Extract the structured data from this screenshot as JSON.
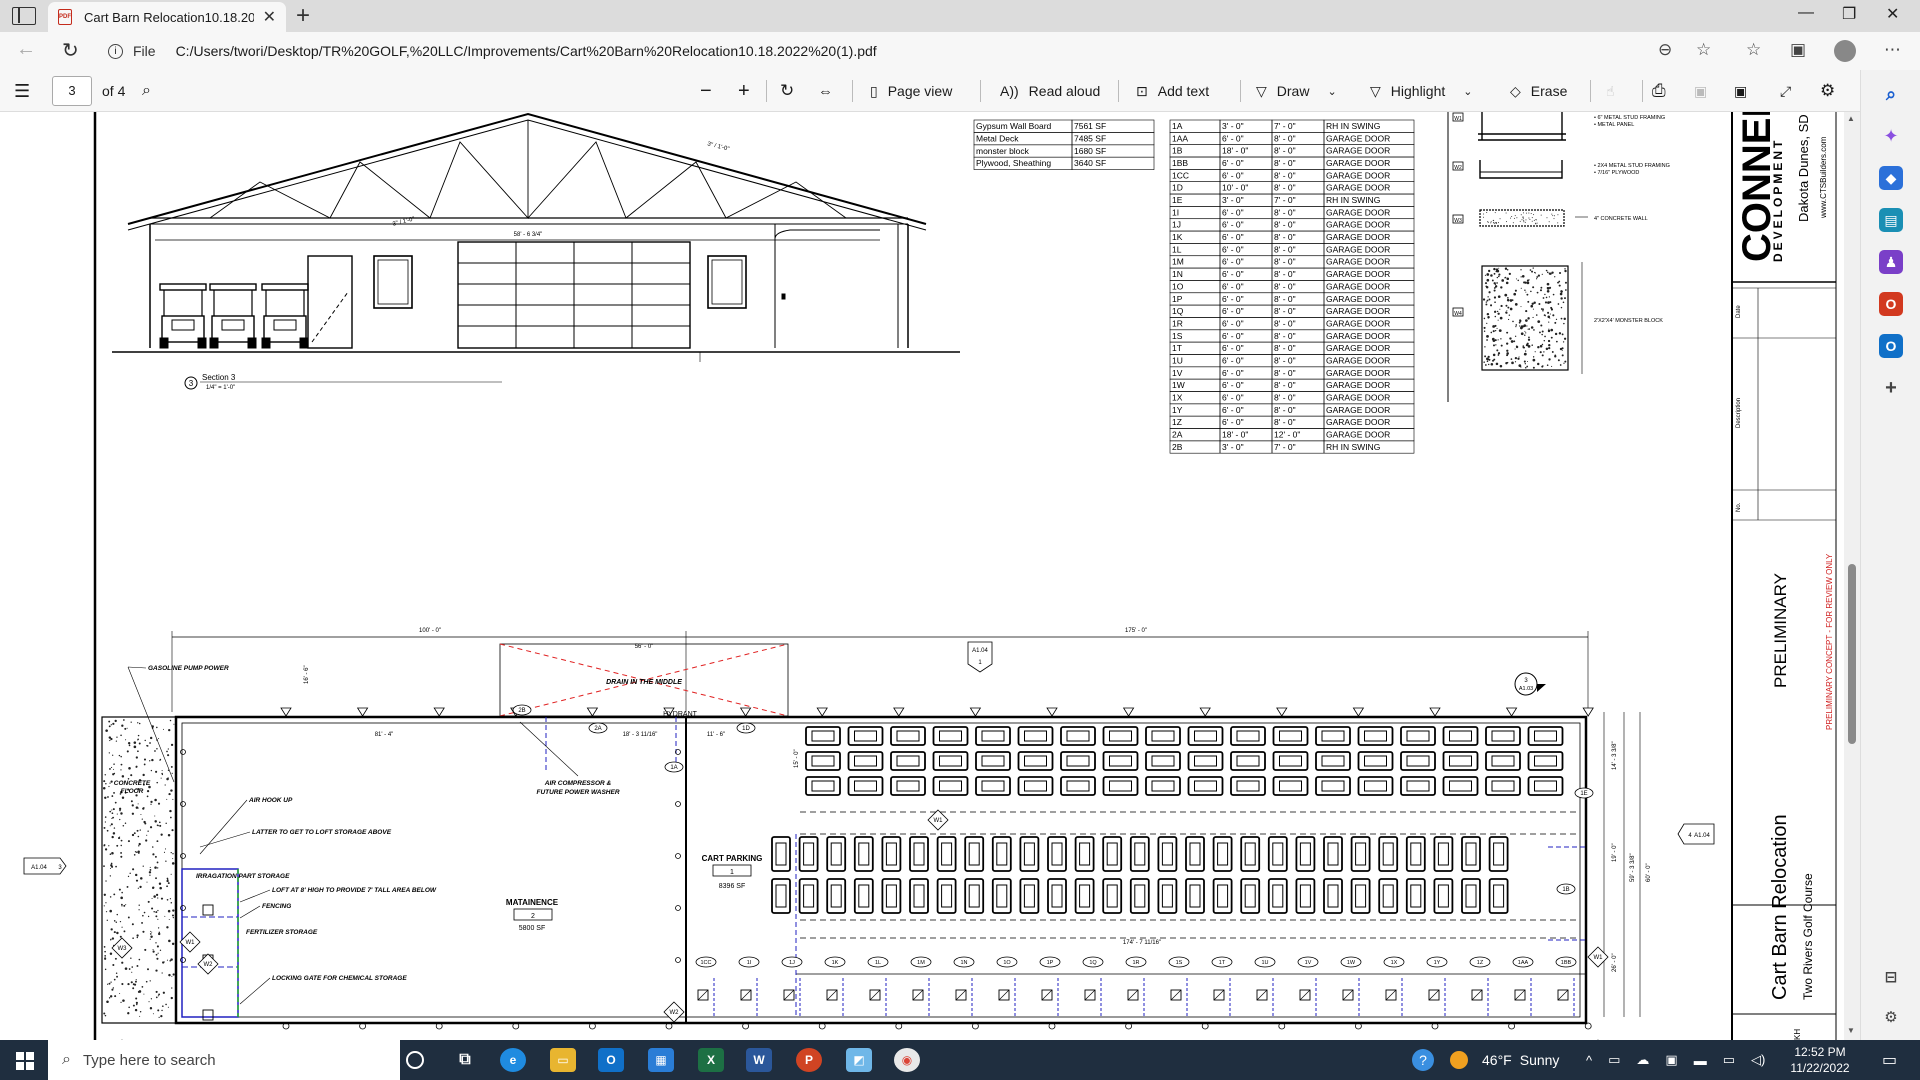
{
  "browser": {
    "tab_title": "Cart Barn Relocation10.18.2022 (",
    "pdf_icon_text": "PDF",
    "file_label": "File",
    "url": "C:/Users/twori/Desktop/TR%20GOLF,%20LLC/Improvements/Cart%20Barn%20Relocation10.18.2022%20(1).pdf"
  },
  "toolbar": {
    "page_number": "3",
    "page_count": "of 4",
    "page_view": "Page view",
    "read_aloud": "Read aloud",
    "add_text": "Add text",
    "draw": "Draw",
    "highlight": "Highlight",
    "erase": "Erase"
  },
  "materials": [
    [
      "Gypsum Wall Board",
      "7561 SF"
    ],
    [
      "Metal Deck",
      "7485 SF"
    ],
    [
      "monster block",
      "1680 SF"
    ],
    [
      "Plywood, Sheathing",
      "3640 SF"
    ]
  ],
  "doors": [
    [
      "1A",
      "3' - 0\"",
      "7' - 0\"",
      "RH IN SWING"
    ],
    [
      "1AA",
      "6' - 0\"",
      "8' - 0\"",
      "GARAGE DOOR"
    ],
    [
      "1B",
      "18' - 0\"",
      "8' - 0\"",
      "GARAGE DOOR"
    ],
    [
      "1BB",
      "6' - 0\"",
      "8' - 0\"",
      "GARAGE DOOR"
    ],
    [
      "1CC",
      "6' - 0\"",
      "8' - 0\"",
      "GARAGE DOOR"
    ],
    [
      "1D",
      "10' - 0\"",
      "8' - 0\"",
      "GARAGE DOOR"
    ],
    [
      "1E",
      "3' - 0\"",
      "7' - 0\"",
      "RH IN SWING"
    ],
    [
      "1I",
      "6' - 0\"",
      "8' - 0\"",
      "GARAGE DOOR"
    ],
    [
      "1J",
      "6' - 0\"",
      "8' - 0\"",
      "GARAGE DOOR"
    ],
    [
      "1K",
      "6' - 0\"",
      "8' - 0\"",
      "GARAGE DOOR"
    ],
    [
      "1L",
      "6' - 0\"",
      "8' - 0\"",
      "GARAGE DOOR"
    ],
    [
      "1M",
      "6' - 0\"",
      "8' - 0\"",
      "GARAGE DOOR"
    ],
    [
      "1N",
      "6' - 0\"",
      "8' - 0\"",
      "GARAGE DOOR"
    ],
    [
      "1O",
      "6' - 0\"",
      "8' - 0\"",
      "GARAGE DOOR"
    ],
    [
      "1P",
      "6' - 0\"",
      "8' - 0\"",
      "GARAGE DOOR"
    ],
    [
      "1Q",
      "6' - 0\"",
      "8' - 0\"",
      "GARAGE DOOR"
    ],
    [
      "1R",
      "6' - 0\"",
      "8' - 0\"",
      "GARAGE DOOR"
    ],
    [
      "1S",
      "6' - 0\"",
      "8' - 0\"",
      "GARAGE DOOR"
    ],
    [
      "1T",
      "6' - 0\"",
      "8' - 0\"",
      "GARAGE DOOR"
    ],
    [
      "1U",
      "6' - 0\"",
      "8' - 0\"",
      "GARAGE DOOR"
    ],
    [
      "1V",
      "6' - 0\"",
      "8' - 0\"",
      "GARAGE DOOR"
    ],
    [
      "1W",
      "6' - 0\"",
      "8' - 0\"",
      "GARAGE DOOR"
    ],
    [
      "1X",
      "6' - 0\"",
      "8' - 0\"",
      "GARAGE DOOR"
    ],
    [
      "1Y",
      "6' - 0\"",
      "8' - 0\"",
      "GARAGE DOOR"
    ],
    [
      "1Z",
      "6' - 0\"",
      "8' - 0\"",
      "GARAGE DOOR"
    ],
    [
      "2A",
      "18' - 0\"",
      "12' - 0\"",
      "GARAGE DOOR"
    ],
    [
      "2B",
      "3' - 0\"",
      "7' - 0\"",
      "RH IN SWING"
    ]
  ],
  "details": {
    "d1_a": "• 6\" METAL STUD FRAMING",
    "d1_b": "• METAL PANEL",
    "d2_a": "• 2X4 METAL STUD FRAMING",
    "d2_b": "• 7/16\" PLYWOOD",
    "d3": "4\" CONCRETE WALL",
    "d4": "2'X2'X4' MONSTER BLOCK",
    "tags": [
      "W1",
      "W2",
      "W3",
      "W4"
    ]
  },
  "elevation": {
    "dim_left": "3\" / 1'-0\"",
    "dim_right": "3\" / 1'-0\"",
    "dim_width": "58' - 6 3/4\"",
    "section_title": "Section 3",
    "section_scale": "1/4\" = 1'-0\"",
    "section_num": "3"
  },
  "titleblock": {
    "brand_big": "CONNEL",
    "brand_sub": "DEVELOPMENT",
    "city": "Dakota Dunes, SD",
    "web": "www.CTSBuilders.com",
    "date_label": "Date",
    "desc_label": "Description",
    "no_label": "No.",
    "preliminary": "PRELIMINARY",
    "prelim_note": "PRELIMINARY CONCEPT - FOR REVIEW ONLY",
    "project": "Cart Barn Relocation",
    "client": "Two Rivers Golf Course",
    "sheet": "KH"
  },
  "plan": {
    "dim_100": "100' - 0\"",
    "dim_56": "56' - 0\"",
    "dim_175": "175' - 0\"",
    "dim_16": "16' - 6\"",
    "dim_81": "81' - 4\"",
    "dim_18": "18' - 3 11/16\"",
    "dim_11": "11' - 6\"",
    "dim_174": "174' - 7 11/16\"",
    "gasoline": "GASOLINE PUMP POWER",
    "drain": "DRAIN IN THE MIDDLE",
    "hydrant": "HYDRANT",
    "concrete": "CONCRETE",
    "floor": "FLOOR",
    "air_hook": "AIR HOOK UP",
    "ladder": "LATTER TO GET TO LOFT STORAGE ABOVE",
    "irrigation": "IRRAGATION PART STORAGE",
    "loft": "LOFT AT 8' HIGH TO PROVIDE 7' TALL AREA BELOW",
    "fencing": "FENCING",
    "fertilizer": "FERTILIZER STORAGE",
    "locking": "LOCKING GATE FOR CHEMICAL STORAGE",
    "air_comp": "AIR COMPRESSOR &",
    "washer": "FUTURE POWER WASHER",
    "maint": "MATAINENCE",
    "maint_num": "2",
    "maint_sf": "5800 SF",
    "cart": "CART PARKING",
    "cart_num": "1",
    "cart_sf": "8396 SF",
    "ref_a104": "A1.04",
    "ref_a103": "A1.03",
    "ref_4": "4",
    "ref_3": "3",
    "ref_1": "1",
    "tag_2b": "2B",
    "tag_2a": "2A",
    "tag_1a": "1A",
    "tag_1d": "1D",
    "tag_1e": "1E",
    "tag_1b": "1B",
    "tag_w1": "W1",
    "tag_w2": "W2",
    "tag_w3": "W3",
    "dim_v1": "14' - 3 3/8\"",
    "dim_v2": "19' - 0\"",
    "dim_v3": "59' - 3 3/8\"",
    "dim_v4": "60' - 0\"",
    "dim_v5": "26' - 0\"",
    "dim_v6": "15' - 0\"",
    "bottom_doors": [
      "1CC",
      "1I",
      "1J",
      "1K",
      "1L",
      "1M",
      "1N",
      "1O",
      "1P",
      "1Q",
      "1R",
      "1S",
      "1T",
      "1U",
      "1V",
      "1W",
      "1X",
      "1Y",
      "1Z",
      "1AA",
      "1BB"
    ]
  },
  "taskbar": {
    "search_placeholder": "Type here to search",
    "temp": "46°F",
    "weather": "Sunny",
    "time": "12:52 PM",
    "date": "11/22/2022"
  }
}
